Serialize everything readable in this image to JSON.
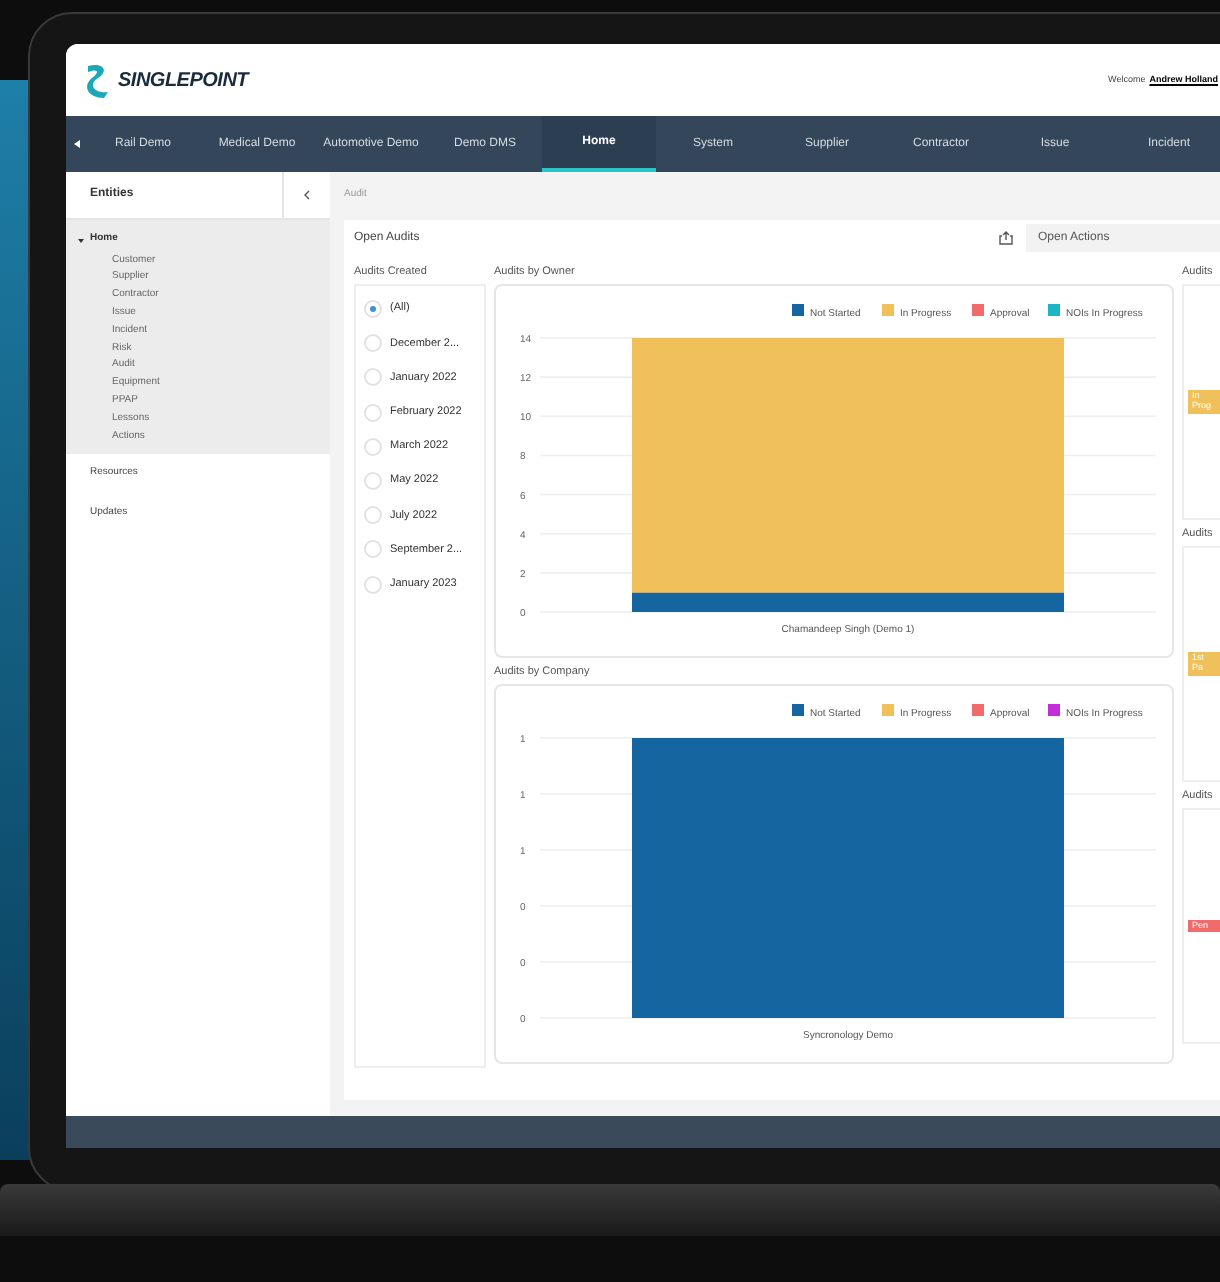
{
  "header": {
    "logo": "SINGLEPOINT",
    "welcome": "Welcome",
    "user": "Andrew Holland"
  },
  "nav": [
    {
      "label": "Rail Demo",
      "selected": false
    },
    {
      "label": "Medical Demo",
      "selected": false
    },
    {
      "label": "Automotive Demo",
      "selected": false
    },
    {
      "label": "Demo DMS",
      "selected": false
    },
    {
      "label": "Home",
      "selected": true
    },
    {
      "label": "System",
      "selected": false
    },
    {
      "label": "Supplier",
      "selected": false
    },
    {
      "label": "Contractor",
      "selected": false
    },
    {
      "label": "Issue",
      "selected": false
    },
    {
      "label": "Incident",
      "selected": false
    }
  ],
  "sidebar": {
    "title": "Entities",
    "items": [
      {
        "label": "Home",
        "expanded": true,
        "children": [
          {
            "label": "Customer"
          },
          {
            "label": "Supplier"
          },
          {
            "label": "Contractor"
          },
          {
            "label": "Issue"
          },
          {
            "label": "Incident"
          },
          {
            "label": "Risk"
          },
          {
            "label": "Audit"
          },
          {
            "label": "Equipment"
          },
          {
            "label": "PPAP"
          },
          {
            "label": "Lessons"
          },
          {
            "label": "Actions"
          }
        ]
      },
      {
        "label": "Resources",
        "expanded": false
      },
      {
        "label": "Updates",
        "expanded": false
      }
    ]
  },
  "breadcrumb": "Audit",
  "panel": {
    "title": "Open Audits",
    "tab": "Open Actions"
  },
  "filter": {
    "title": "Audits Created",
    "options": [
      {
        "label": "(All)",
        "selected": true
      },
      {
        "label": "December 2...",
        "selected": false
      },
      {
        "label": "January 2022",
        "selected": false
      },
      {
        "label": "February 2022",
        "selected": false
      },
      {
        "label": "March 2022",
        "selected": false
      },
      {
        "label": "May 2022",
        "selected": false
      },
      {
        "label": "July 2022",
        "selected": false
      },
      {
        "label": "September 2...",
        "selected": false
      },
      {
        "label": "January 2023",
        "selected": false
      }
    ]
  },
  "charts": [
    {
      "title": "Audits by Owner",
      "chart_data": {
        "type": "bar",
        "stacked": true,
        "categories": [
          "Chamandeep Singh (Demo 1)"
        ],
        "series": [
          {
            "name": "Not Started",
            "color": "#1565a0",
            "values": [
              1
            ]
          },
          {
            "name": "In Progress",
            "color": "#f0c05a",
            "values": [
              13
            ]
          },
          {
            "name": "Approval",
            "color": "#f26b6b",
            "values": [
              0
            ]
          },
          {
            "name": "NOIs In Progress",
            "color": "#1bb5c4",
            "values": [
              0
            ]
          }
        ],
        "grid": true,
        "legend": "top-right",
        "ylim": [
          0,
          14
        ],
        "yticks": [
          0,
          2,
          4,
          6,
          8,
          10,
          12,
          14
        ]
      }
    },
    {
      "title": "Audits by Company",
      "chart_data": {
        "type": "bar",
        "stacked": true,
        "categories": [
          "Syncronology Demo"
        ],
        "series": [
          {
            "name": "Not Started",
            "color": "#1565a0",
            "values": [
              1
            ]
          },
          {
            "name": "In Progress",
            "color": "#f0c05a",
            "values": [
              0
            ]
          },
          {
            "name": "Approval",
            "color": "#f26b6b",
            "values": [
              0
            ]
          },
          {
            "name": "NOIs In Progress",
            "color": "#c42ed8",
            "values": [
              0
            ]
          }
        ],
        "grid": true,
        "legend": "top-right",
        "ylim": [
          0,
          1
        ],
        "yticks": [
          {
            "value": 0,
            "label": "0"
          },
          {
            "value": 0.2,
            "label": "0"
          },
          {
            "value": 0.4,
            "label": "0"
          },
          {
            "value": 0.6,
            "label": "1"
          },
          {
            "value": 0.8,
            "label": "1"
          },
          {
            "value": 1,
            "label": "1"
          }
        ]
      }
    }
  ],
  "side_panels": [
    {
      "title": "Audits",
      "tag": "In Prog",
      "color": "#f0c05a"
    },
    {
      "title": "Audits",
      "tag": "1st Pa",
      "color": "#f0c05a"
    },
    {
      "title": "Audits",
      "tag": "Pen",
      "color": "#f26b6b"
    }
  ]
}
